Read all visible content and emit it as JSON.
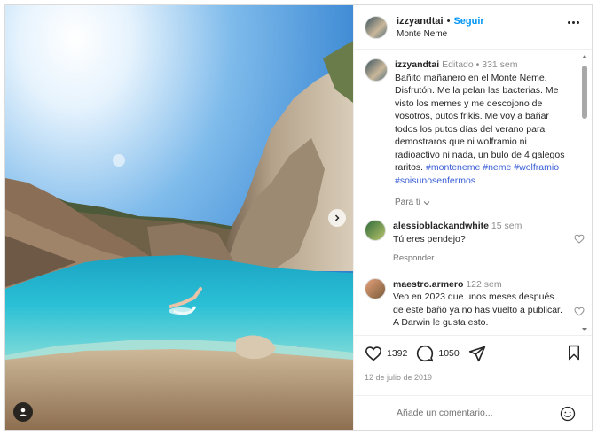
{
  "post": {
    "username": "izzyandtai",
    "follow_label": "Seguir",
    "location": "Monte Neme",
    "caption_edited": "Editado",
    "caption_age": "331 sem",
    "caption_text": "Bañito mañanero en el Monte Neme. Disfrutón. Me la pelan las bacterias. Me visto los memes y me descojono de vosotros, putos frikis. Me voy a bañar todos los putos días del verano para demostraros que ni wolframio ni radioactivo ni nada, un bulo de 4 galegos raritos.",
    "hashtags": [
      "#monteneme",
      "#neme",
      "#wolframio",
      "#soisunosenfermos"
    ],
    "translate_label": "Para ti"
  },
  "comments": [
    {
      "username": "alessioblackandwhite",
      "age": "15 sem",
      "text": "Tú eres pendejo?",
      "reply_label": "Responder"
    },
    {
      "username": "maestro.armero",
      "age": "122 sem",
      "text": "Veo en 2023 que unos meses después de este baño ya no has vuelto a publicar. A Darwin le gusta esto."
    }
  ],
  "actions": {
    "likes": "1392",
    "comments_count": "1050",
    "date": "12 de julio de 2019"
  },
  "add_comment": {
    "placeholder": "Añade un comentario..."
  },
  "icons": {
    "more": "more-options-icon",
    "next": "chevron-right-icon",
    "tag": "user-tag-icon",
    "heart": "heart-icon",
    "comment": "comment-icon",
    "share": "share-icon",
    "bookmark": "bookmark-icon",
    "emoji": "emoji-icon"
  },
  "colors": {
    "accent": "#0095f6",
    "hashtag": "#3a5fd6",
    "muted": "#8e8e8e"
  }
}
